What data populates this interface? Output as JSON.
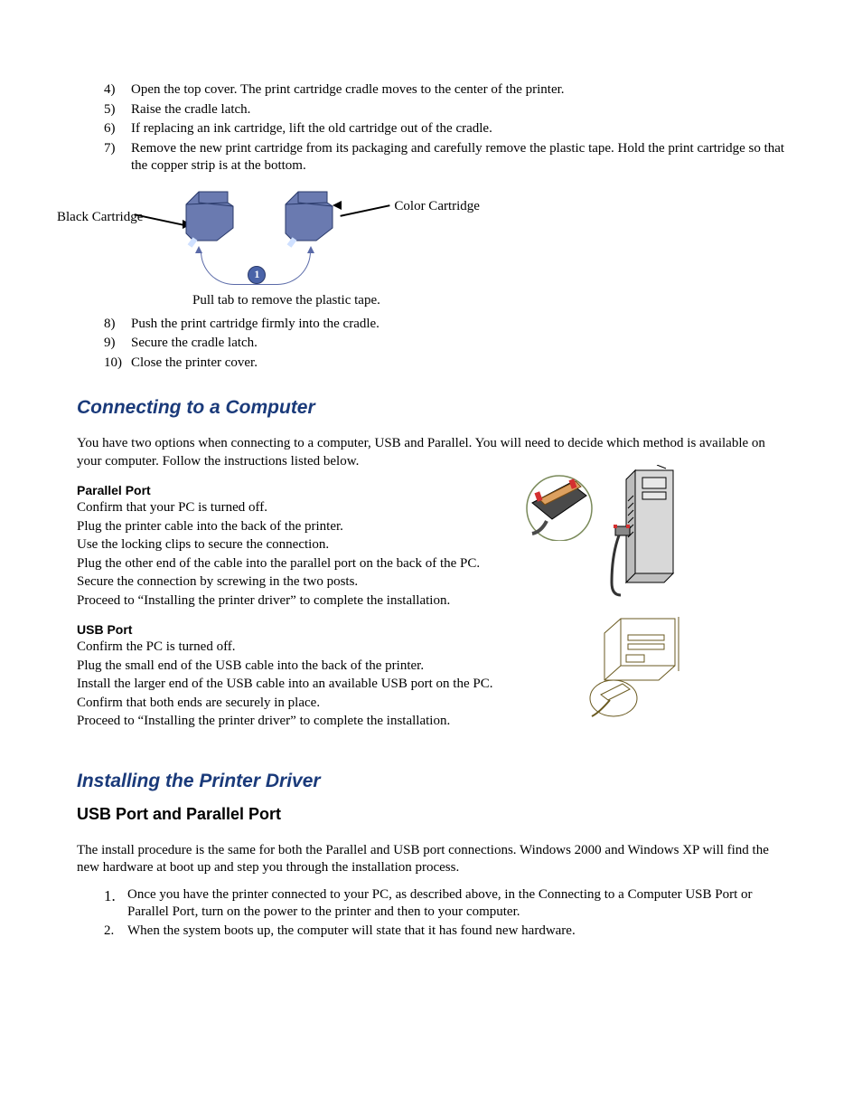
{
  "steps_top": [
    {
      "n": "4)",
      "t": "Open the top cover.  The print cartridge cradle moves to the center of the printer."
    },
    {
      "n": "5)",
      "t": "Raise the cradle latch."
    },
    {
      "n": "6)",
      "t": "If replacing an ink cartridge, lift the old cartridge out of the cradle."
    },
    {
      "n": "7)",
      "t": "Remove the new print cartridge from its packaging and carefully remove the plastic tape.   Hold the print cartridge so that the copper strip is at the bottom."
    }
  ],
  "cartridge": {
    "black": "Black Cartridge",
    "color": "Color Cartridge",
    "caption": "Pull tab to remove the plastic tape.",
    "badge": "1"
  },
  "steps_mid": [
    {
      "n": "8)",
      "t": "Push the print cartridge firmly into the cradle."
    },
    {
      "n": "9)",
      "t": "Secure the cradle latch."
    },
    {
      "n": "10)",
      "t": "Close the printer cover."
    }
  ],
  "connecting": {
    "heading": "Connecting to a Computer",
    "intro": "You have two options when connecting to a computer, USB and Parallel.  You will need to decide which method is available on your computer.  Follow the instructions listed below."
  },
  "parallel": {
    "title": "Parallel Port",
    "lines": [
      "Confirm that your PC is turned off.",
      "Plug the printer cable into the back of the printer.",
      "Use the locking clips to secure the connection.",
      "Plug the other end of the cable into the parallel port on the back of the PC.",
      "Secure the connection by screwing in the two posts.",
      "Proceed to “Installing the printer driver” to complete the installation."
    ]
  },
  "usb": {
    "title": "USB Port",
    "lines": [
      "Confirm the PC is turned off.",
      "Plug the small end of the USB cable into the back of the printer.",
      "Install the larger end of the USB cable into an available USB port on the PC.",
      "Confirm that both ends are securely in place.",
      "Proceed to “Installing the printer driver” to complete the installation."
    ]
  },
  "installing": {
    "heading": "Installing the Printer Driver",
    "sub": "USB Port and Parallel Port",
    "intro": "The install procedure is the same for both the Parallel and USB port connections.  Windows 2000 and Windows XP will find the new hardware at boot up and step you through the installation process.",
    "steps": [
      {
        "n": "1.",
        "t": "Once you have the printer connected to your PC, as described above, in the Connecting to a Computer USB Port or Parallel Port, turn on the power to the printer and then to your computer."
      },
      {
        "n": "2.",
        "t": "When the system boots up, the computer will state that it has found new hardware."
      }
    ]
  }
}
